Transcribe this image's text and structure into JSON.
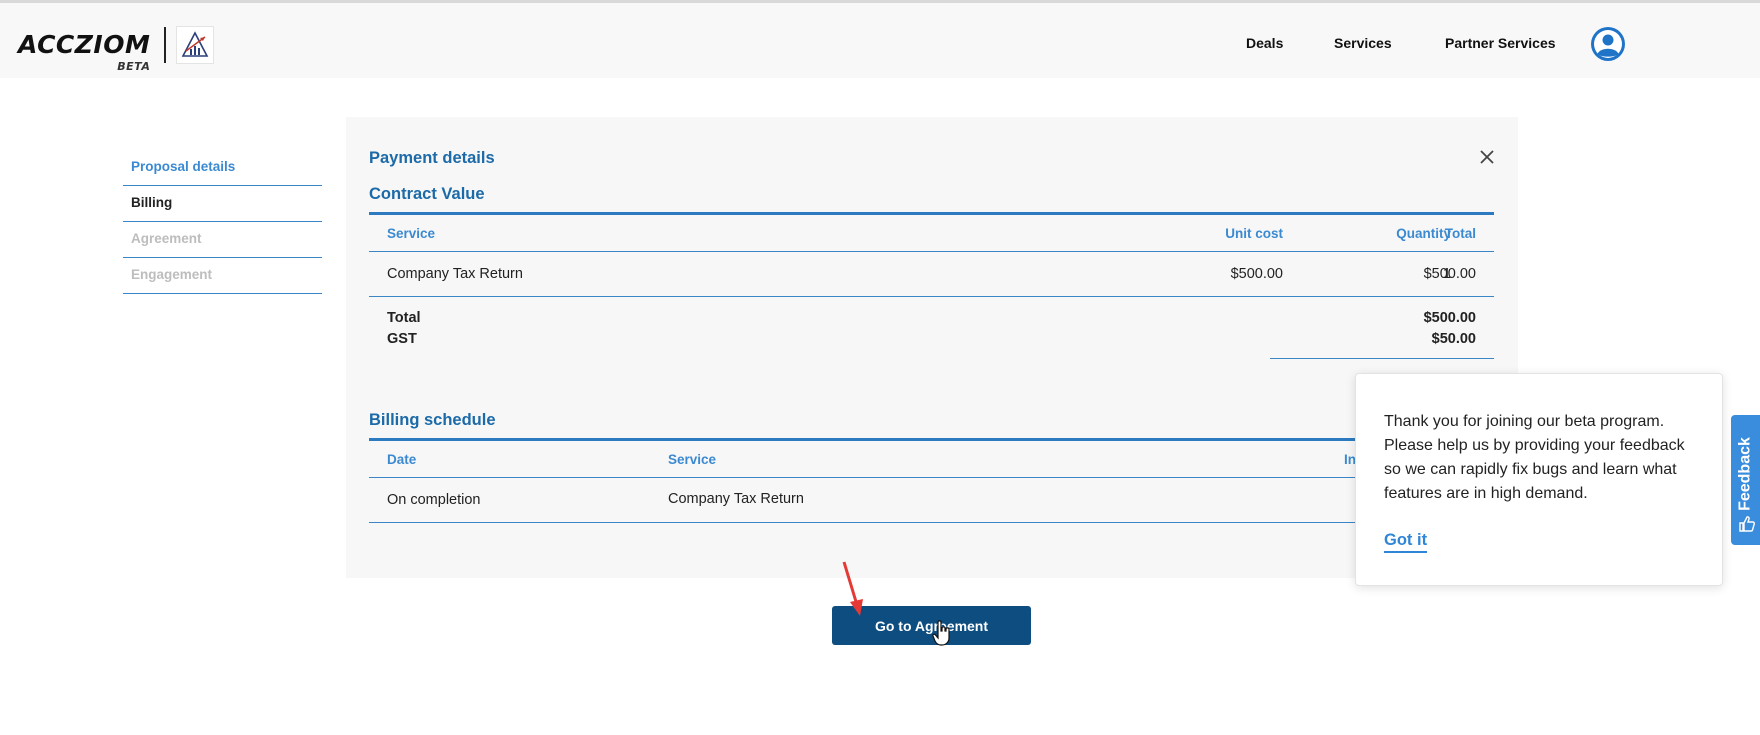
{
  "header": {
    "logo_text": "ACCZIOM",
    "logo_badge_text": "BETA",
    "nav": [
      "Deals",
      "Services",
      "Partner Services"
    ]
  },
  "sidebar": {
    "items": [
      {
        "label": "Proposal details",
        "state": "active"
      },
      {
        "label": "Billing",
        "state": "current"
      },
      {
        "label": "Agreement",
        "state": "disabled"
      },
      {
        "label": "Engagement",
        "state": "disabled"
      }
    ]
  },
  "panel": {
    "title": "Payment details",
    "contract": {
      "title": "Contract Value",
      "headers": {
        "service": "Service",
        "unit_cost": "Unit cost",
        "quantity": "Quantity",
        "total": "Total"
      },
      "rows": [
        {
          "service": "Company Tax Return",
          "unit_cost": "$500.00",
          "quantity": "1",
          "total": "$500.00"
        }
      ],
      "summary": [
        {
          "label": "Total",
          "value": "$500.00"
        },
        {
          "label": "GST",
          "value": "$50.00"
        }
      ]
    },
    "billing": {
      "title": "Billing schedule",
      "headers": {
        "date": "Date",
        "service": "Service",
        "third": "In"
      },
      "rows": [
        {
          "date": "On completion",
          "service": "Company Tax Return"
        }
      ]
    }
  },
  "cta": {
    "label": "Go to Agreement"
  },
  "popup": {
    "message": "Thank you for joining our beta program. Please help us by providing your feedback so we can rapidly fix bugs and learn what features are in high demand.",
    "link": "Got it"
  },
  "feedback": {
    "label": "Feedback"
  },
  "colors": {
    "accent": "#1c6aa8",
    "link": "#3b8ad1",
    "button": "#0d4d80",
    "feedback": "#3a8ddd"
  }
}
